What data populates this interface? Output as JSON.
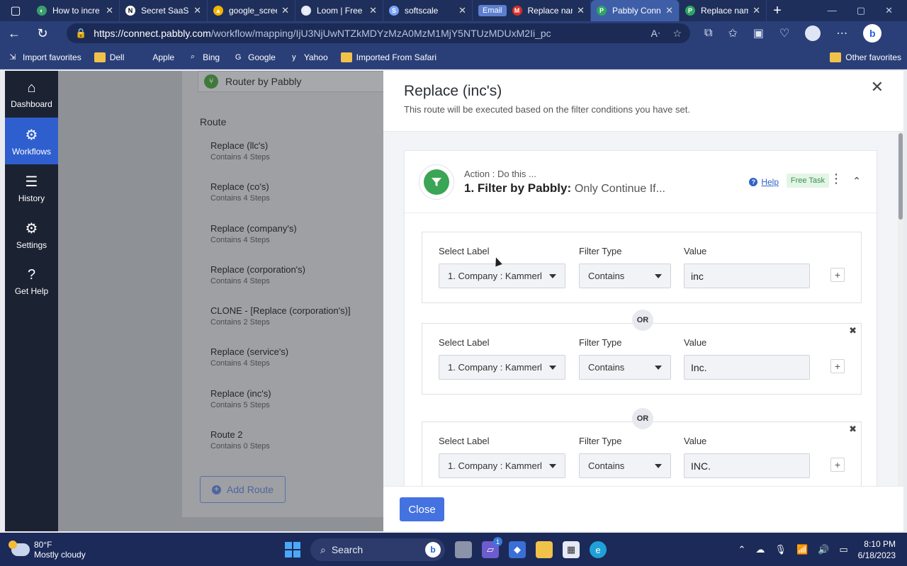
{
  "browser": {
    "tabs": [
      {
        "title": "How to incre",
        "fav_color": "#3b9e6e",
        "fav_glyph": "◐"
      },
      {
        "title": "Secret SaaS G",
        "fav_color": "#ffffff",
        "fav_glyph": "N"
      },
      {
        "title": "google_scree",
        "fav_color": "#f4b400",
        "fav_glyph": "▲"
      },
      {
        "title": "Loom | Free S",
        "fav_color": "#e6e9f5",
        "fav_glyph": "▯"
      },
      {
        "title": "softscale",
        "fav_color": "#7aa2f7",
        "fav_glyph": "S"
      },
      {
        "title": "Replace nam",
        "badge": "Email",
        "fav_color": "#d93025",
        "fav_glyph": "M"
      },
      {
        "title": "Pabbly Conn",
        "fav_color": "#2fa463",
        "fav_glyph": "P",
        "active": true
      },
      {
        "title": "Replace nam",
        "fav_color": "#2fa463",
        "fav_glyph": "P"
      }
    ],
    "url_host": "https://connect.pabbly.com",
    "url_path": "/workflow/mapping/IjU3NjUwNTZkMDYzMzA0MzM1MjY5NTUzMDUxM2Ii_pc",
    "favorites": [
      {
        "label": "Import favorites",
        "icon": "import-icon"
      },
      {
        "label": "Dell",
        "icon": "folder-icon"
      },
      {
        "label": "Apple",
        "icon": "apple-icon"
      },
      {
        "label": "Bing",
        "icon": "search-icon"
      },
      {
        "label": "Google",
        "icon": "google-icon"
      },
      {
        "label": "Yahoo",
        "icon": "yahoo-icon"
      },
      {
        "label": "Imported From Safari",
        "icon": "folder-icon"
      }
    ],
    "other_favorites": "Other favorites"
  },
  "sidebar": {
    "items": [
      {
        "label": "Dashboard",
        "icon": "home-icon"
      },
      {
        "label": "Workflows",
        "icon": "workflow-icon",
        "active": true
      },
      {
        "label": "History",
        "icon": "list-icon"
      },
      {
        "label": "Settings",
        "icon": "gear-icon"
      },
      {
        "label": "Get Help",
        "icon": "question-icon"
      }
    ]
  },
  "routes": {
    "router_label": "Router by Pabbly",
    "title": "Route",
    "items": [
      {
        "name": "Replace (llc's)",
        "steps": "Contains 4 Steps"
      },
      {
        "name": "Replace (co's)",
        "steps": "Contains 4 Steps"
      },
      {
        "name": "Replace (company's)",
        "steps": "Contains 4 Steps"
      },
      {
        "name": "Replace (corporation's)",
        "steps": "Contains 4 Steps"
      },
      {
        "name": "CLONE - [Replace (corporation's)]",
        "steps": "Contains 2 Steps"
      },
      {
        "name": "Replace (service's)",
        "steps": "Contains 4 Steps"
      },
      {
        "name": "Replace (inc's)",
        "steps": "Contains 5 Steps"
      },
      {
        "name": "Route 2",
        "steps": "Contains 0 Steps"
      }
    ],
    "add_route": "Add Route"
  },
  "modal": {
    "title": "Replace (inc's)",
    "subtitle": "This route will be executed based on the filter conditions you have set.",
    "close_label": "Close",
    "card": {
      "action": "Action : Do this ...",
      "step": "1. Filter by Pabbly:",
      "step_suffix": "Only Continue If...",
      "help": "Help",
      "free_task": "Free Task"
    },
    "col_labels": {
      "label": "Select Label",
      "type": "Filter Type",
      "value": "Value"
    },
    "or_label": "OR",
    "conditions": [
      {
        "label": "1. Company : Kammerl",
        "type": "Contains",
        "value": "inc"
      },
      {
        "label": "1. Company : Kammerl",
        "type": "Contains",
        "value": "Inc."
      },
      {
        "label": "1. Company : Kammerl",
        "type": "Contains",
        "value": "INC."
      }
    ]
  },
  "taskbar": {
    "temp": "80°F",
    "weather": "Mostly cloudy",
    "search": "Search",
    "time": "8:10 PM",
    "date": "6/18/2023",
    "chat_badge": "1"
  }
}
